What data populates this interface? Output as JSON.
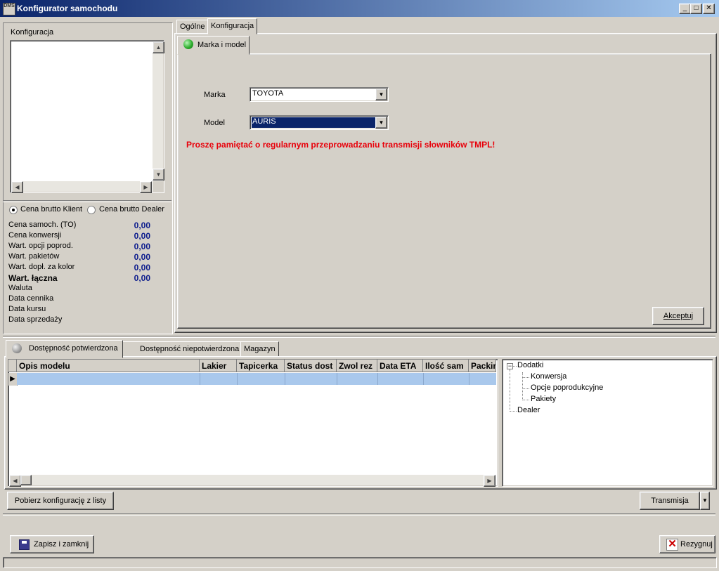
{
  "window": {
    "title": "Konfigurator samochodu",
    "app_icon_text": "DMS",
    "min_glyph": "_",
    "max_glyph": "□",
    "close_glyph": "✕"
  },
  "left_panel": {
    "list_label": "Konfiguracja",
    "radio_client": "Cena brutto Klient",
    "radio_dealer": "Cena brutto Dealer",
    "radio_selected": "client",
    "prices": [
      {
        "label": "Cena samoch. (TO)",
        "value": "0,00",
        "bold": false
      },
      {
        "label": "Cena konwersji",
        "value": "0,00",
        "bold": false
      },
      {
        "label": "Wart. opcji poprod.",
        "value": "0,00",
        "bold": false
      },
      {
        "label": "Wart. pakietów",
        "value": "0,00",
        "bold": false
      },
      {
        "label": "Wart. dopł. za kolor",
        "value": "0,00",
        "bold": false
      },
      {
        "label": "Wart. łączna",
        "value": "0,00",
        "bold": true
      }
    ],
    "info_labels": [
      "Waluta",
      "Data cennika",
      "Data kursu",
      "Data sprzedaży"
    ]
  },
  "top_tabs": {
    "tab1": "Ogólne",
    "tab2": "Konfiguracja",
    "active": "Konfiguracja"
  },
  "inner_tab": {
    "label": "Marka i model",
    "status_color": "#2fae2f"
  },
  "form": {
    "marka_label": "Marka",
    "marka_value": "TOYOTA",
    "model_label": "Model",
    "model_value": "AURIS",
    "warning": "Proszę pamiętać o regularnym przeprowadzaniu transmisji słowników TMPL!",
    "accept_button": "Akceptuj"
  },
  "bottom_tabs": {
    "tab1": "Dostępność potwierdzona",
    "tab2": "Dostępność niepotwierdzona",
    "tab3": "Magazyn"
  },
  "grid": {
    "columns": [
      "Opis modelu",
      "Lakier",
      "Tapicerka",
      "Status dost",
      "Zwol rez",
      "Data ETA",
      "Ilość sam",
      "Packin"
    ],
    "selected_row_color": "#a9c8ec"
  },
  "tree": {
    "root1": "Dodatki",
    "children": [
      "Konwersja",
      "Opcje poprodukcyjne",
      "Pakiety"
    ],
    "root2": "Dealer"
  },
  "buttons": {
    "fetch_config": "Pobierz konfigurację z listy",
    "transmission": "Transmisja",
    "save_close": "Zapisz i zamknij",
    "cancel": "Rezygnuj"
  }
}
